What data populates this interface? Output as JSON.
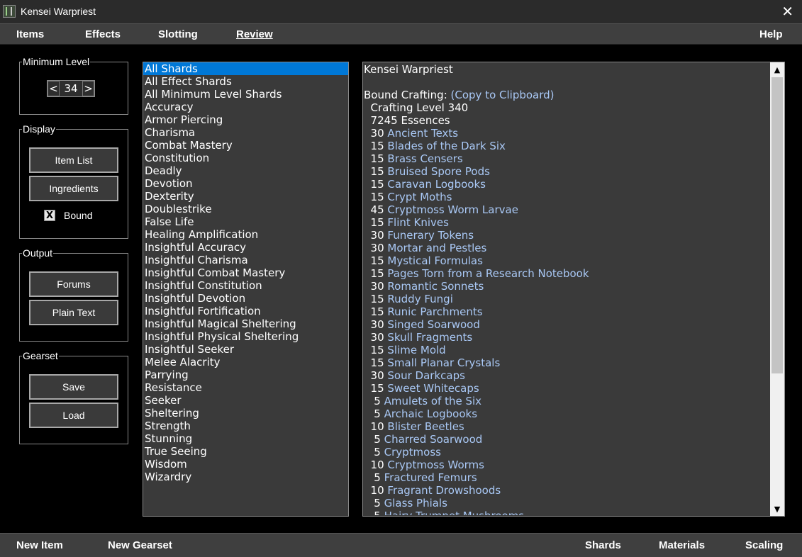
{
  "window": {
    "title": "Kensei Warpriest",
    "close_label": "✕"
  },
  "menu": {
    "items": [
      "Items",
      "Effects",
      "Slotting",
      "Review"
    ],
    "help": "Help"
  },
  "min_level": {
    "label": "Minimum Level",
    "dec": "<",
    "value": "34",
    "inc": ">"
  },
  "display": {
    "label": "Display",
    "item_list": "Item List",
    "ingredients": "Ingredients",
    "bound_mark": "X",
    "bound_label": "Bound"
  },
  "output": {
    "label": "Output",
    "forums": "Forums",
    "plain_text": "Plain Text"
  },
  "gearset": {
    "label": "Gearset",
    "save": "Save",
    "load": "Load"
  },
  "shards": [
    "All Shards",
    "All Effect Shards",
    "All Minimum Level Shards",
    "Accuracy",
    "Armor Piercing",
    "Charisma",
    "Combat Mastery",
    "Constitution",
    "Deadly",
    "Devotion",
    "Dexterity",
    "Doublestrike",
    "False Life",
    "Healing Amplification",
    "Insightful Accuracy",
    "Insightful Charisma",
    "Insightful Combat Mastery",
    "Insightful Constitution",
    "Insightful Devotion",
    "Insightful Fortification",
    "Insightful Magical Sheltering",
    "Insightful Physical Sheltering",
    "Insightful Seeker",
    "Melee Alacrity",
    "Parrying",
    "Resistance",
    "Seeker",
    "Sheltering",
    "Strength",
    "Stunning",
    "True Seeing",
    "Wisdom",
    "Wizardry"
  ],
  "review": {
    "title": "Kensei Warpriest",
    "bound_label": "Bound Crafting: ",
    "copy_link": "(Copy to Clipboard)",
    "crafting_level": "  Crafting Level 340",
    "essences": "  7245 Essences",
    "materials": [
      [
        "  30",
        "Ancient Texts"
      ],
      [
        "  15",
        "Blades of the Dark Six"
      ],
      [
        "  15",
        "Brass Censers"
      ],
      [
        "  15",
        "Bruised Spore Pods"
      ],
      [
        "  15",
        "Caravan Logbooks"
      ],
      [
        "  15",
        "Crypt Moths"
      ],
      [
        "  45",
        "Cryptmoss Worm Larvae"
      ],
      [
        "  15",
        "Flint Knives"
      ],
      [
        "  30",
        "Funerary Tokens"
      ],
      [
        "  30",
        "Mortar and Pestles"
      ],
      [
        "  15",
        "Mystical Formulas"
      ],
      [
        "  15",
        "Pages Torn from a Research Notebook"
      ],
      [
        "  30",
        "Romantic Sonnets"
      ],
      [
        "  15",
        "Ruddy Fungi"
      ],
      [
        "  15",
        "Runic Parchments"
      ],
      [
        "  30",
        "Singed Soarwood"
      ],
      [
        "  30",
        "Skull Fragments"
      ],
      [
        "  15",
        "Slime Mold"
      ],
      [
        "  15",
        "Small Planar Crystals"
      ],
      [
        "  30",
        "Sour Darkcaps"
      ],
      [
        "  15",
        "Sweet Whitecaps"
      ],
      [
        "   5",
        "Amulets of the Six"
      ],
      [
        "   5",
        "Archaic Logbooks"
      ],
      [
        "  10",
        "Blister Beetles"
      ],
      [
        "   5",
        "Charred Soarwood"
      ],
      [
        "   5",
        "Cryptmoss"
      ],
      [
        "  10",
        "Cryptmoss Worms"
      ],
      [
        "   5",
        "Fractured Femurs"
      ],
      [
        "  10",
        "Fragrant Drowshoods"
      ],
      [
        "   5",
        "Glass Phials"
      ],
      [
        "   5",
        "Hairy Trumpet Mushrooms"
      ]
    ]
  },
  "statusbar": {
    "new_item": "New Item",
    "new_gearset": "New Gearset",
    "shards": "Shards",
    "materials": "Materials",
    "scaling": "Scaling"
  },
  "colors": {
    "selected": "#0078d7",
    "link": "#a9c8f5",
    "panel": "#3a3a3a",
    "bar": "#3f3f3f"
  }
}
